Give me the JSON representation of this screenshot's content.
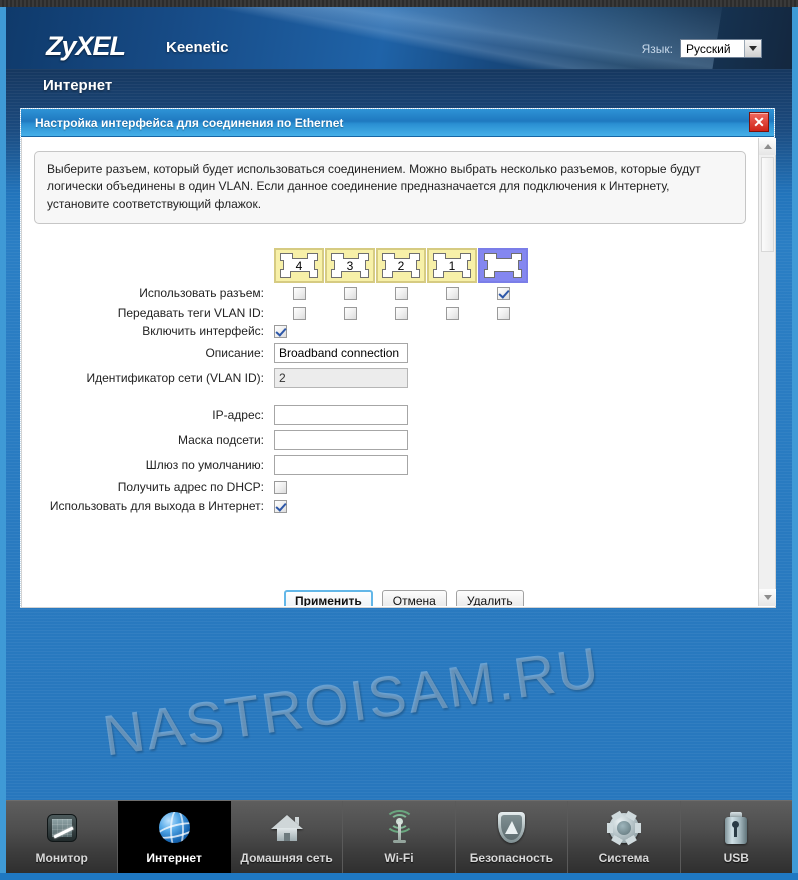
{
  "header": {
    "logo": "ZyXEL",
    "product": "Keenetic",
    "language_label": "Язык:",
    "language_value": "Русский"
  },
  "page": {
    "title": "Интернет",
    "watermark": "NASTROISAM.RU"
  },
  "dialog": {
    "title": "Настройка интерфейса для соединения по Ethernet",
    "close_label": "✕",
    "info_text": "Выберите разъем, который будет использоваться соединением. Можно выбрать несколько разъемов, которые будут логически объединены в один VLAN. Если данное соединение предназначается для подключения к Интернету, установите соответствующий флажок.",
    "ports": {
      "use_port_label": "Использовать разъем:",
      "vlan_tag_label": "Передавать теги VLAN ID:",
      "items": [
        {
          "label": "4",
          "type": "lan",
          "color": "#f7f0a8",
          "use_port": false,
          "vlan_tag": false
        },
        {
          "label": "3",
          "type": "lan",
          "color": "#f7f0a8",
          "use_port": false,
          "vlan_tag": false
        },
        {
          "label": "2",
          "type": "lan",
          "color": "#f7f0a8",
          "use_port": false,
          "vlan_tag": false
        },
        {
          "label": "1",
          "type": "lan",
          "color": "#f7f0a8",
          "use_port": false,
          "vlan_tag": false
        },
        {
          "label": "",
          "type": "wan",
          "color": "#8487f0",
          "use_port": true,
          "vlan_tag": false
        }
      ]
    },
    "fields": {
      "enable_interface_label": "Включить интерфейс:",
      "enable_interface_checked": true,
      "description_label": "Описание:",
      "description_value": "Broadband connection",
      "vlan_id_label": "Идентификатор сети (VLAN ID):",
      "vlan_id_value": "2",
      "ip_address_label": "IP-адрес:",
      "ip_address_value": "",
      "subnet_mask_label": "Маска подсети:",
      "subnet_mask_value": "",
      "default_gateway_label": "Шлюз по умолчанию:",
      "default_gateway_value": "",
      "dhcp_label": "Получить адрес по DHCP:",
      "dhcp_checked": false,
      "use_for_internet_label": "Использовать для выхода в Интернет:",
      "use_for_internet_checked": true
    },
    "buttons": {
      "apply": "Применить",
      "cancel": "Отмена",
      "delete": "Удалить"
    }
  },
  "nav": {
    "items": [
      {
        "label": "Монитор",
        "icon": "chart-monitor-icon",
        "active": false
      },
      {
        "label": "Интернет",
        "icon": "globe-icon",
        "active": true
      },
      {
        "label": "Домашняя сеть",
        "icon": "home-icon",
        "active": false
      },
      {
        "label": "Wi-Fi",
        "icon": "wifi-antenna-icon",
        "active": false
      },
      {
        "label": "Безопасность",
        "icon": "shield-icon",
        "active": false
      },
      {
        "label": "Система",
        "icon": "gear-icon",
        "active": false
      },
      {
        "label": "USB",
        "icon": "usb-drive-icon",
        "active": false
      }
    ]
  }
}
